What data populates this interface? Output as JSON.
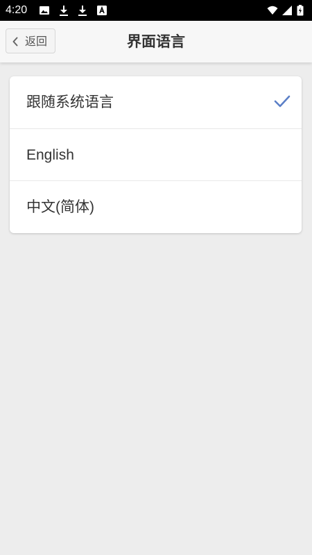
{
  "status_bar": {
    "time": "4:20",
    "icons": [
      "image-icon",
      "download-icon",
      "download-icon",
      "font-icon",
      "wifi-icon",
      "signal-icon",
      "battery-icon"
    ]
  },
  "nav": {
    "back_label": "返回",
    "title": "界面语言"
  },
  "options": [
    {
      "label": "跟随系统语言",
      "selected": true
    },
    {
      "label": "English",
      "selected": false
    },
    {
      "label": "中文(简体)",
      "selected": false
    }
  ],
  "colors": {
    "accent": "#5b7fc7",
    "background": "#ededed",
    "status_bar": "#000000"
  }
}
